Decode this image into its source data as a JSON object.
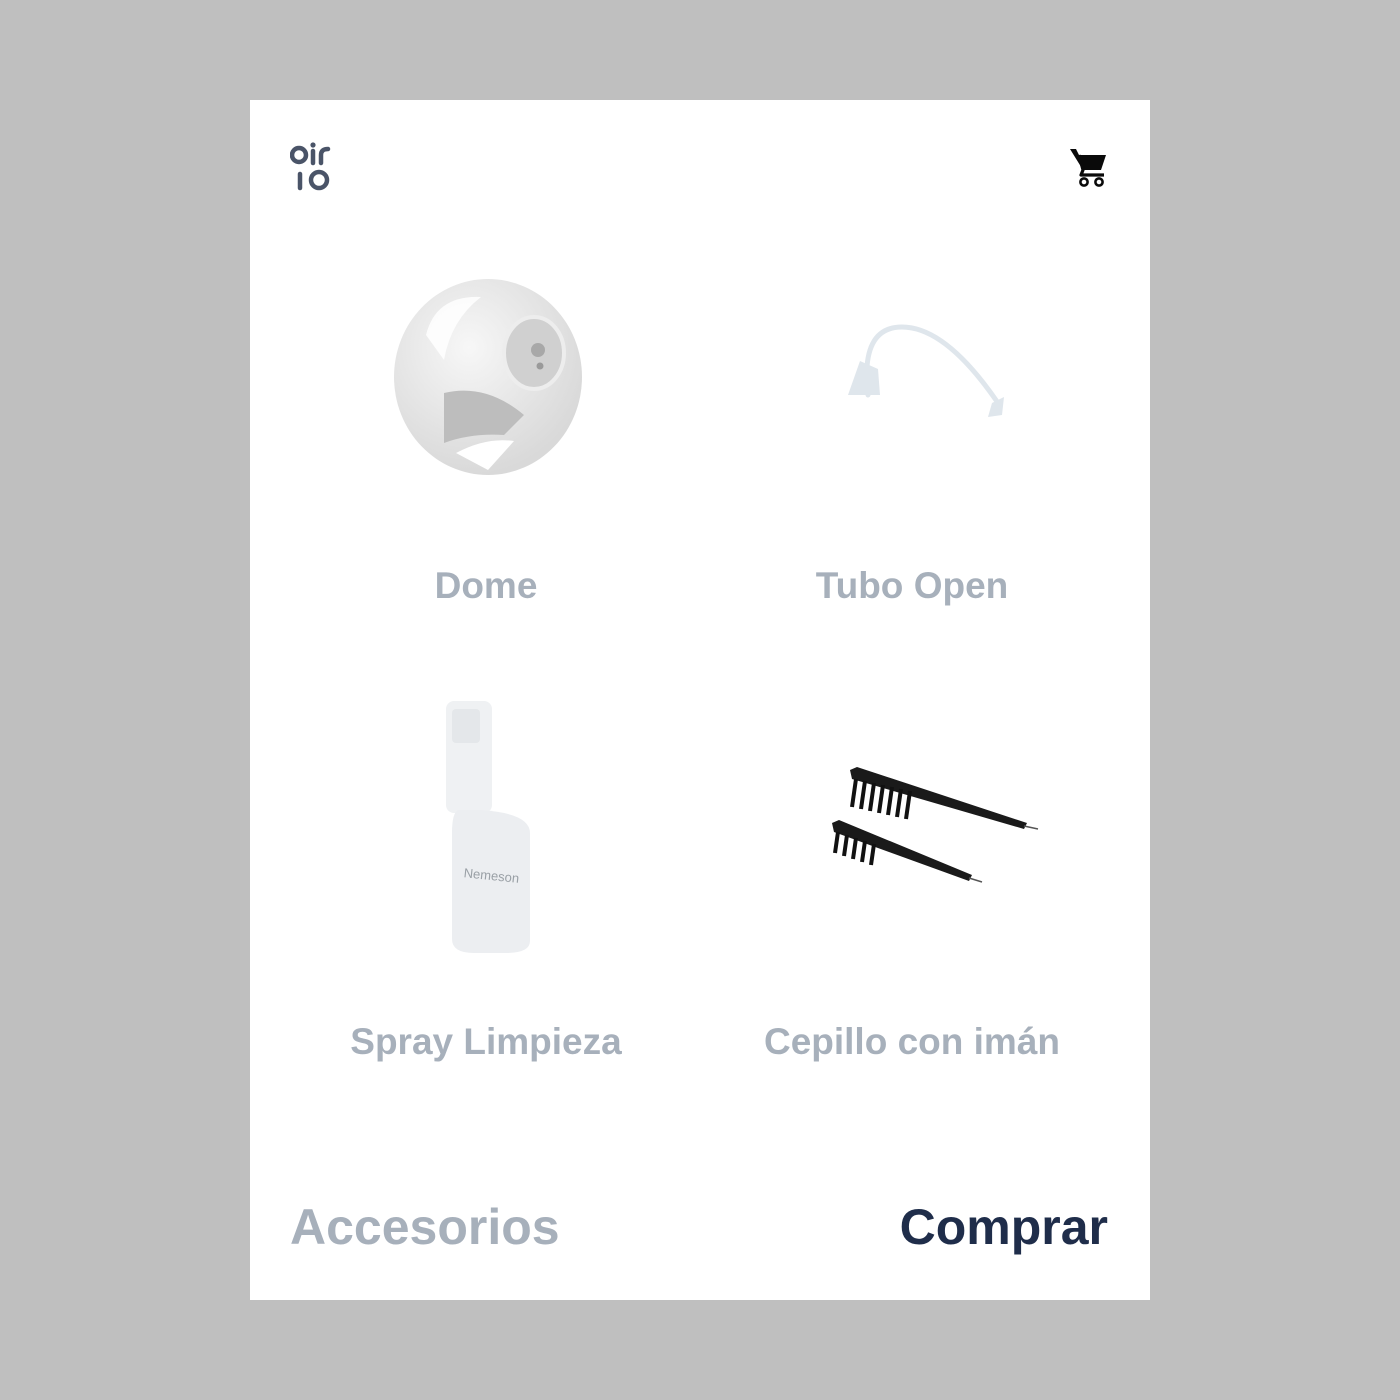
{
  "header": {
    "logo_name": "oir-io-logo",
    "cart_icon": "shopping-cart-icon"
  },
  "products": [
    {
      "name": "Dome",
      "image": "dome-image"
    },
    {
      "name": "Tubo Open",
      "image": "open-tube-image"
    },
    {
      "name": "Spray Limpieza",
      "image": "cleaning-spray-image",
      "label_on_bottle": "Nemeson"
    },
    {
      "name": "Cepillo con imán",
      "image": "magnet-brush-image"
    }
  ],
  "footer": {
    "section_title": "Accesorios",
    "buy_label": "Comprar"
  },
  "colors": {
    "product_text": "#a7b0bb",
    "buy_text": "#1f2d4a",
    "background": "#bfbfbf"
  }
}
